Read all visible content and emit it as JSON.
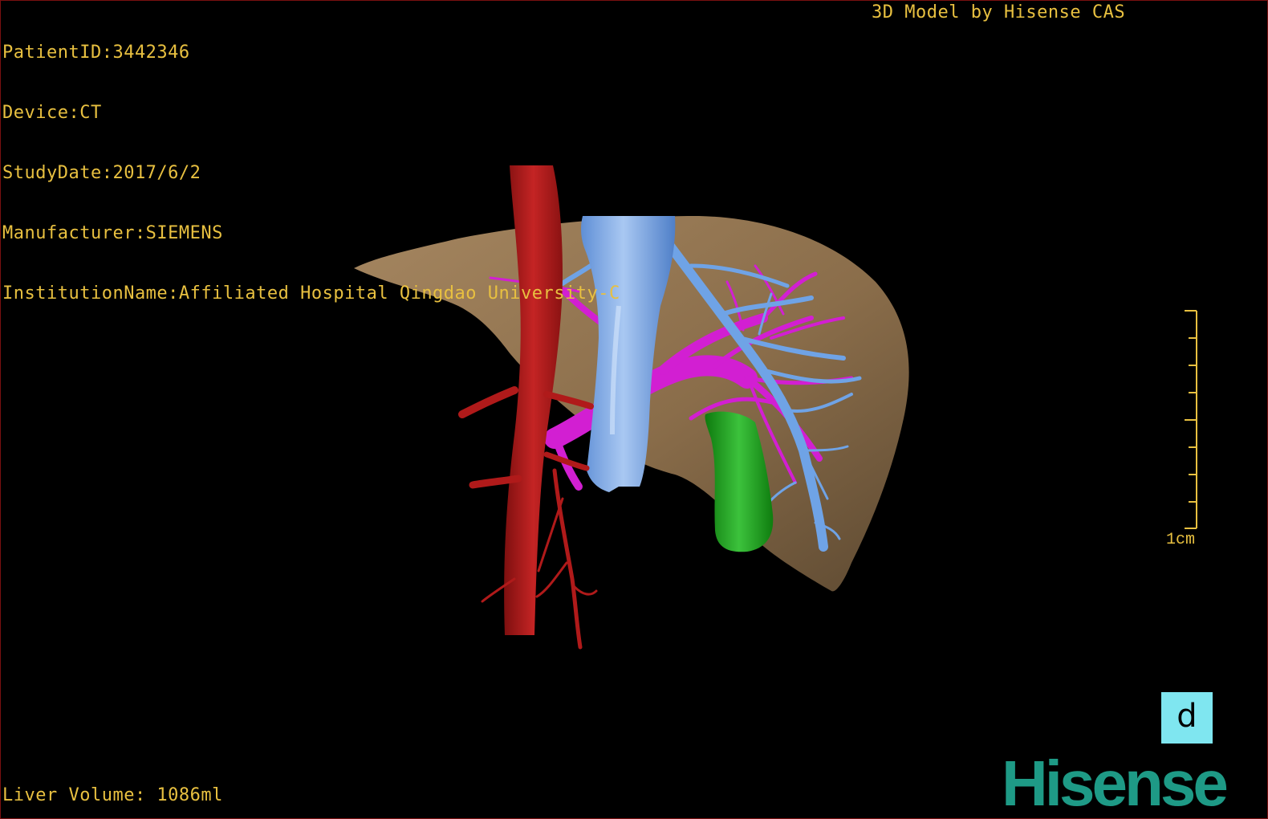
{
  "overlay": {
    "patient_id": "PatientID:3442346",
    "device": "Device:CT",
    "study_date": "StudyDate:2017/6/2",
    "manufacturer": "Manufacturer:SIEMENS",
    "institution": "InstitutionName:Affiliated Hospital Qingdao University-C",
    "credit": "3D Model by Hisense CAS",
    "liver_volume": "Liver Volume: 1086ml"
  },
  "scale": {
    "label": "1cm"
  },
  "view_cube": {
    "label": "d"
  },
  "brand": {
    "logo_text": "Hisense"
  },
  "colors": {
    "overlay_text": "#e8c040",
    "liver": "#8a6d4a",
    "aorta": "#b01a1a",
    "vena_cava": "#6fa3e6",
    "portal_vein": "#d21fd2",
    "gallbladder": "#1fa21f",
    "view_cube_bg": "#7fe6f0",
    "brand": "#1e9a86"
  }
}
